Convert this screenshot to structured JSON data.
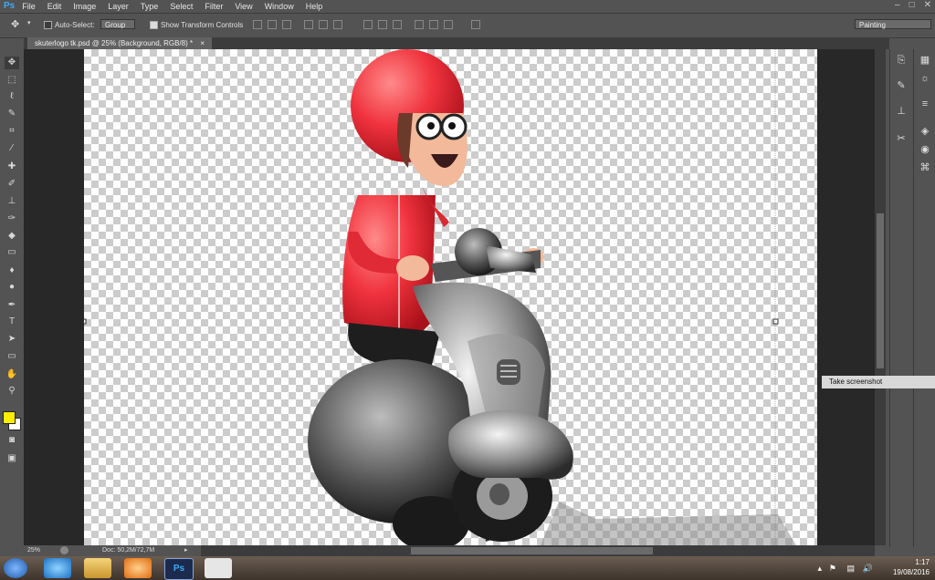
{
  "app": {
    "logo": "Ps"
  },
  "menu": [
    "File",
    "Edit",
    "Image",
    "Layer",
    "Type",
    "Select",
    "Filter",
    "View",
    "Window",
    "Help"
  ],
  "window_controls": [
    "–",
    "□",
    "✕"
  ],
  "options_bar": {
    "auto_select_label": "Auto-Select:",
    "group_value": "Group",
    "show_transform_label": "Show Transform Controls",
    "workspace_value": "Painting"
  },
  "document_tab": {
    "title": "skuterlogo tk.psd @ 25% (Background, RGB/8) *",
    "close": "×"
  },
  "tools": [
    "move-tool",
    "marquee-tool",
    "lasso-tool",
    "quick-select-tool",
    "crop-tool",
    "eyedropper-tool",
    "healing-tool",
    "brush-tool",
    "stamp-tool",
    "history-brush-tool",
    "eraser-tool",
    "gradient-tool",
    "blur-tool",
    "dodge-tool",
    "pen-tool",
    "type-tool",
    "path-select-tool",
    "shape-tool",
    "hand-tool",
    "zoom-tool"
  ],
  "colors": {
    "foreground": "#ffee00",
    "background": "#ffffff",
    "ps_blue": "#3fa9f5"
  },
  "status": {
    "zoom": "25%",
    "doc": "Doc: 50,2M/72,7M"
  },
  "tooltip": "Take screenshot",
  "taskbar": {
    "time": "1:17",
    "date": "19/08/2016"
  }
}
